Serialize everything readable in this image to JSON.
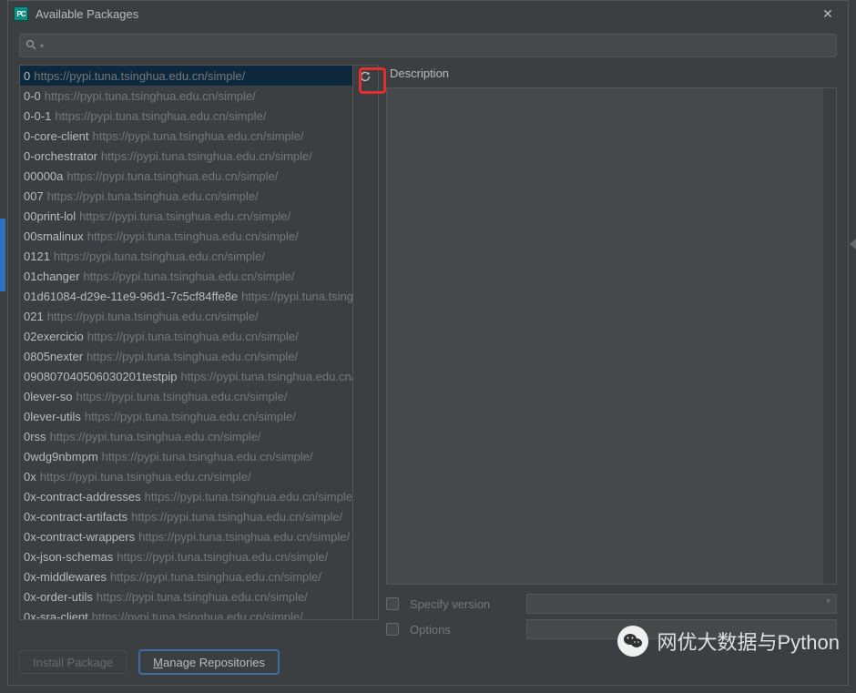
{
  "window": {
    "app_icon_text": "PC",
    "title": "Available Packages"
  },
  "search": {
    "placeholder": ""
  },
  "repo_url": "https://pypi.tuna.tsinghua.edu.cn/simple/",
  "packages": [
    "0",
    "0-0",
    "0-0-1",
    "0-core-client",
    "0-orchestrator",
    "00000a",
    "007",
    "00print-lol",
    "00smalinux",
    "0121",
    "01changer",
    "01d61084-d29e-11e9-96d1-7c5cf84ffe8e",
    "021",
    "02exercicio",
    "0805nexter",
    "090807040506030201testpip",
    "0lever-so",
    "0lever-utils",
    "0rss",
    "0wdg9nbmpm",
    "0x",
    "0x-contract-addresses",
    "0x-contract-artifacts",
    "0x-contract-wrappers",
    "0x-json-schemas",
    "0x-middlewares",
    "0x-order-utils",
    "0x-sra-client"
  ],
  "selected_index": 0,
  "right": {
    "description_label": "Description",
    "specify_version_label": "Specify version",
    "options_label": "Options"
  },
  "buttons": {
    "install": "Install Package",
    "manage_prefix": "M",
    "manage_rest": "anage Repositories"
  },
  "watermark": {
    "text": "网优大数据与Python"
  }
}
